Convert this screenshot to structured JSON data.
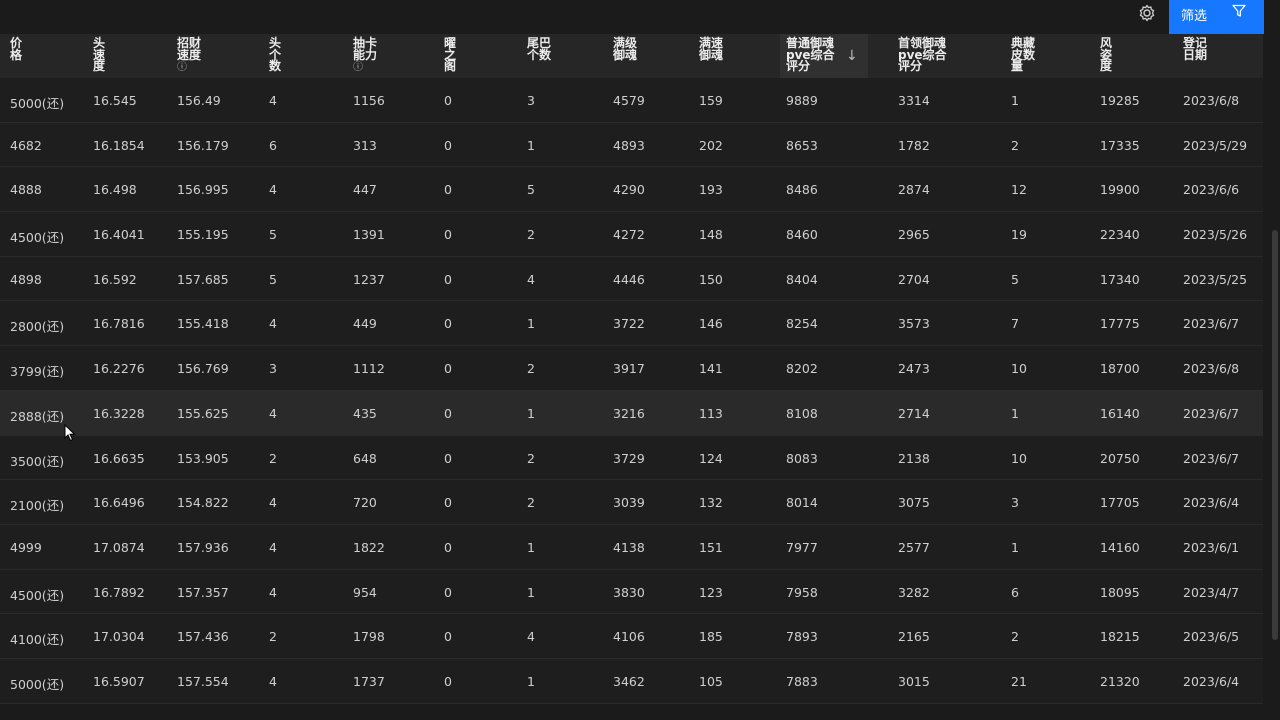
{
  "toolbar": {
    "settings_icon": "gear-icon",
    "filter_label": "筛选",
    "filter_icon": "funnel-icon",
    "accent": "#1677ff"
  },
  "columns": [
    {
      "key": "price",
      "label": [
        "价",
        "格"
      ],
      "info": false
    },
    {
      "key": "head_speed",
      "label": [
        "头",
        "速",
        "度"
      ],
      "info": false
    },
    {
      "key": "recruit_speed",
      "label": [
        "招财",
        "速度"
      ],
      "info": true
    },
    {
      "key": "heads",
      "label": [
        "头",
        "个",
        "数"
      ],
      "info": false
    },
    {
      "key": "draw",
      "label": [
        "抽卡",
        "能力"
      ],
      "info": true
    },
    {
      "key": "yao",
      "label": [
        "曜",
        "之",
        "阁"
      ],
      "info": false
    },
    {
      "key": "tails",
      "label": [
        "尾巴",
        "个数"
      ],
      "info": false
    },
    {
      "key": "max_level",
      "label": [
        "满级",
        "御魂"
      ],
      "info": false
    },
    {
      "key": "max_speed",
      "label": [
        "满速",
        "御魂"
      ],
      "info": false
    },
    {
      "key": "pve_normal",
      "label": [
        "普通御魂",
        "pve综合",
        "评分"
      ],
      "info": false,
      "sorted": "desc"
    },
    {
      "key": "pve_boss",
      "label": [
        "首领御魂",
        "pve综合",
        "评分"
      ],
      "info": false
    },
    {
      "key": "skins",
      "label": [
        "典藏",
        "皮数",
        "量"
      ],
      "info": false
    },
    {
      "key": "style",
      "label": [
        "风",
        "姿",
        "度"
      ],
      "info": false
    },
    {
      "key": "date",
      "label": [
        "登记",
        "日期"
      ],
      "info": false
    }
  ],
  "rows": [
    [
      "5000(还)",
      "16.545",
      "156.49",
      "4",
      "1156",
      "0",
      "3",
      "4579",
      "159",
      "9889",
      "3314",
      "1",
      "19285",
      "2023/6/8"
    ],
    [
      "4682",
      "16.1854",
      "156.179",
      "6",
      "313",
      "0",
      "1",
      "4893",
      "202",
      "8653",
      "1782",
      "2",
      "17335",
      "2023/5/29"
    ],
    [
      "4888",
      "16.498",
      "156.995",
      "4",
      "447",
      "0",
      "5",
      "4290",
      "193",
      "8486",
      "2874",
      "12",
      "19900",
      "2023/6/6"
    ],
    [
      "4500(还)",
      "16.4041",
      "155.195",
      "5",
      "1391",
      "0",
      "2",
      "4272",
      "148",
      "8460",
      "2965",
      "19",
      "22340",
      "2023/5/26"
    ],
    [
      "4898",
      "16.592",
      "157.685",
      "5",
      "1237",
      "0",
      "4",
      "4446",
      "150",
      "8404",
      "2704",
      "5",
      "17340",
      "2023/5/25"
    ],
    [
      "2800(还)",
      "16.7816",
      "155.418",
      "4",
      "449",
      "0",
      "1",
      "3722",
      "146",
      "8254",
      "3573",
      "7",
      "17775",
      "2023/6/7"
    ],
    [
      "3799(还)",
      "16.2276",
      "156.769",
      "3",
      "1112",
      "0",
      "2",
      "3917",
      "141",
      "8202",
      "2473",
      "10",
      "18700",
      "2023/6/8"
    ],
    [
      "2888(还)",
      "16.3228",
      "155.625",
      "4",
      "435",
      "0",
      "1",
      "3216",
      "113",
      "8108",
      "2714",
      "1",
      "16140",
      "2023/6/7"
    ],
    [
      "3500(还)",
      "16.6635",
      "153.905",
      "2",
      "648",
      "0",
      "2",
      "3729",
      "124",
      "8083",
      "2138",
      "10",
      "20750",
      "2023/6/7"
    ],
    [
      "2100(还)",
      "16.6496",
      "154.822",
      "4",
      "720",
      "0",
      "2",
      "3039",
      "132",
      "8014",
      "3075",
      "3",
      "17705",
      "2023/6/4"
    ],
    [
      "4999",
      "17.0874",
      "157.936",
      "4",
      "1822",
      "0",
      "1",
      "4138",
      "151",
      "7977",
      "2577",
      "1",
      "14160",
      "2023/6/1"
    ],
    [
      "4500(还)",
      "16.7892",
      "157.357",
      "4",
      "954",
      "0",
      "1",
      "3830",
      "123",
      "7958",
      "3282",
      "6",
      "18095",
      "2023/4/7"
    ],
    [
      "4100(还)",
      "17.0304",
      "157.436",
      "2",
      "1798",
      "0",
      "4",
      "4106",
      "185",
      "7893",
      "2165",
      "2",
      "18215",
      "2023/6/5"
    ],
    [
      "5000(还)",
      "16.5907",
      "157.554",
      "4",
      "1737",
      "0",
      "1",
      "3462",
      "105",
      "7883",
      "3015",
      "21",
      "21320",
      "2023/6/4"
    ]
  ],
  "hover_row": 7
}
